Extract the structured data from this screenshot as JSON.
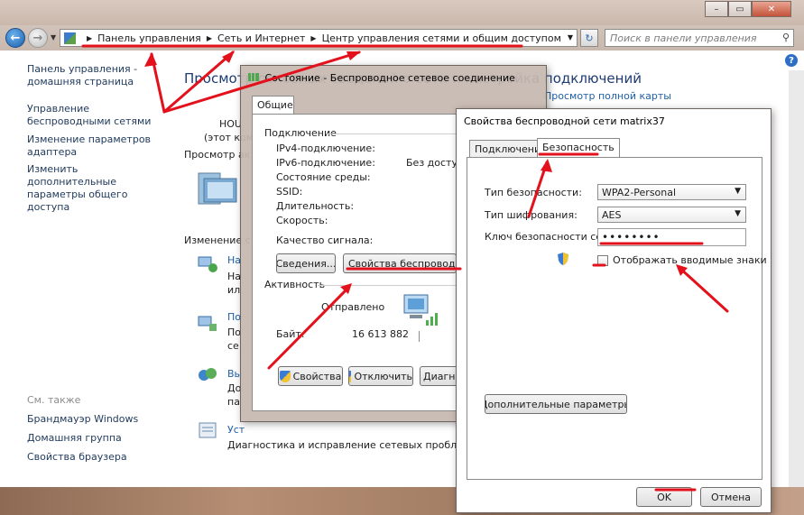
{
  "window_controls": {
    "minimize": "–",
    "maximize": "▭",
    "close": "✕"
  },
  "address": {
    "crumbs": [
      "Панель управления",
      "Сеть и Интернет",
      "Центр управления сетями и общим доступом"
    ],
    "search_placeholder": "Поиск в панели управления"
  },
  "sidebar": {
    "items": [
      "Панель управления - домашняя страница",
      "Управление беспроводными сетями",
      "Изменение параметров адаптера",
      "Изменить дополнительные параметры общего доступа"
    ],
    "see_also": "См. также",
    "see_also_items": [
      "Брандмауэр Windows",
      "Домашняя группа",
      "Свойства браузера"
    ]
  },
  "main": {
    "heading": "Просмотр основных сведений о сети и настройка подключений",
    "view_full_map": "Просмотр полной карты",
    "computer_name": "HOU",
    "computer_sub": "(этот ком",
    "active_networks": "Просмотр ак",
    "change_settings": "Изменение с",
    "task1_title": "На",
    "task1_lines": [
      "На",
      "ил"
    ],
    "task2_title": "По",
    "task2_lines": [
      "По",
      "се"
    ],
    "task3_title": "Вы",
    "task3_lines": [
      "До",
      "па"
    ],
    "task4_title": "Уст",
    "task4_desc": "Диагностика и исправление сетевых проблем или п"
  },
  "status_dialog": {
    "title": "Состояние - Беспроводное сетевое соединение",
    "tab": "Общие",
    "group_connection": "Подключение",
    "rows": [
      {
        "label": "IPv4-подключение:",
        "value": ""
      },
      {
        "label": "IPv6-подключение:",
        "value": "Без доступа"
      },
      {
        "label": "Состояние среды:",
        "value": ""
      },
      {
        "label": "SSID:",
        "value": ""
      },
      {
        "label": "Длительность:",
        "value": ""
      },
      {
        "label": "Скорость:",
        "value": ""
      }
    ],
    "signal_quality": "Качество сигнала:",
    "btn_details": "Сведения...",
    "btn_wireless_props": "Свойства беспроводной се",
    "group_activity": "Активность",
    "sent": "Отправлено",
    "bytes_label": "Байт:",
    "bytes_value": "16 613 882",
    "btn_properties": "Свойства",
    "btn_disable": "Отключить",
    "btn_diagnose": "Диагнос"
  },
  "security_dialog": {
    "title": "Свойства беспроводной сети matrix37",
    "tabs": [
      "Подключение",
      "Безопасность"
    ],
    "active_tab": 1,
    "security_type_label": "Тип безопасности:",
    "security_type_value": "WPA2-Personal",
    "encryption_label": "Тип шифрования:",
    "encryption_value": "AES",
    "key_label": "Ключ безопасности сети",
    "key_value": "••••••••",
    "show_chars": "Отображать вводимые знаки",
    "advanced_btn": "Дополнительные параметры",
    "ok": "OK",
    "cancel": "Отмена"
  },
  "colors": {
    "annotation": "#e3111b",
    "link": "#1e5fa8",
    "heading": "#1e3b73"
  }
}
